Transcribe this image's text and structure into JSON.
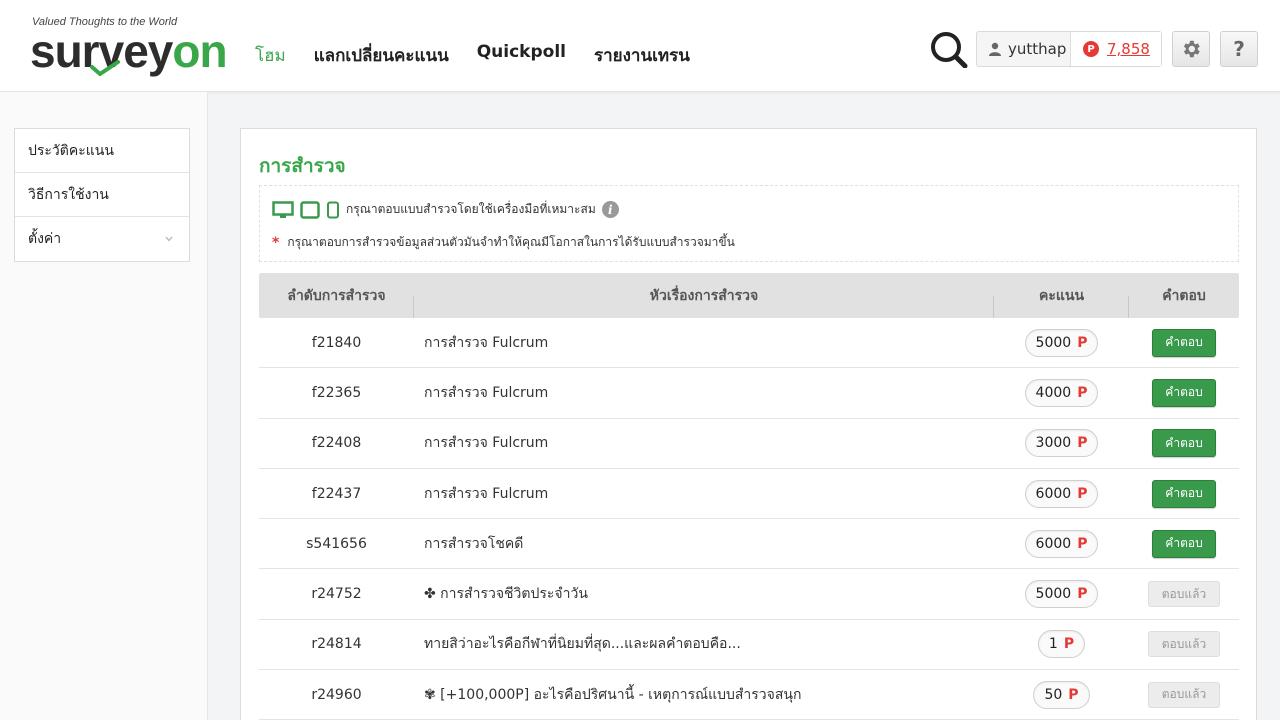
{
  "header": {
    "tagline": "Valued Thoughts to the World",
    "logo_part1": "sur",
    "logo_part2": "v",
    "logo_part3": "ey",
    "logo_part4": "on",
    "nav": [
      {
        "label": "โฮม",
        "active": true
      },
      {
        "label": "แลกเปลี่ยนคะแนน"
      },
      {
        "label": "Quickpoll"
      },
      {
        "label": "รายงานเทรน"
      }
    ],
    "username": "yutthap",
    "points_badge": "P",
    "points": "7,858",
    "help_label": "?"
  },
  "sidebar": {
    "items": [
      {
        "label": "ประวัติคะแนน"
      },
      {
        "label": "วิธีการใช้งาน"
      },
      {
        "label": "ตั้งค่า"
      }
    ]
  },
  "main": {
    "title": "การสำรวจ",
    "notice_device": "กรุณาตอบแบบสำรวจโดยใช้เครื่องมือที่เหมาะสม",
    "info_glyph": "i",
    "notice_star": "*",
    "notice_personal": "กรุณาตอบการสำรวจข้อมูลส่วนตัวมันจำทำให้คุณมีโอกาสในการได้รับแบบสำรวจมาขึ้น",
    "columns": [
      "ลำดับการสำรวจ",
      "หัวเรื่องการสำรวจ",
      "คะแนน",
      "คำตอบ"
    ],
    "point_suffix": "P",
    "rows": [
      {
        "id": "f21840",
        "title": "การสำรวจ Fulcrum",
        "points": "5000",
        "action": "คำตอบ",
        "answered": false
      },
      {
        "id": "f22365",
        "title": "การสำรวจ Fulcrum",
        "points": "4000",
        "action": "คำตอบ",
        "answered": false
      },
      {
        "id": "f22408",
        "title": "การสำรวจ Fulcrum",
        "points": "3000",
        "action": "คำตอบ",
        "answered": false
      },
      {
        "id": "f22437",
        "title": "การสำรวจ Fulcrum",
        "points": "6000",
        "action": "คำตอบ",
        "answered": false
      },
      {
        "id": "s541656",
        "title": "การสำรวจโชคดี",
        "points": "6000",
        "action": "คำตอบ",
        "answered": false
      },
      {
        "id": "r24752",
        "title": "✤ การสำรวจชีวิตประจำวัน",
        "points": "5000",
        "action": "ตอบแล้ว",
        "answered": true
      },
      {
        "id": "r24814",
        "title": "ทายสิว่าอะไรคือกีฬาที่นิยมที่สุด...และผลคำตอบคือ...",
        "points": "1",
        "action": "ตอบแล้ว",
        "answered": true
      },
      {
        "id": "r24960",
        "title": "✾ [+100,000P] อะไรคือปริศนานี้ - เหตุการณ์แบบสำรวจสนุก",
        "points": "50",
        "action": "ตอบแล้ว",
        "answered": true
      }
    ]
  },
  "colors": {
    "brand_green": "#3aa64a",
    "points_red": "#e53935"
  }
}
